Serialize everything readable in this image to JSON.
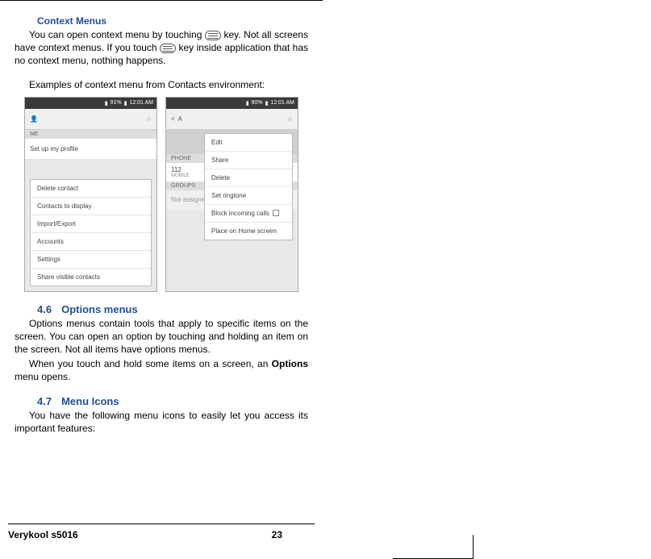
{
  "headings": {
    "context_menus": "Context Menus",
    "options_menus_num": "4.6",
    "options_menus_label": "Options menus",
    "menu_icons_num": "4.7",
    "menu_icons_label": "Menu Icons"
  },
  "paragraphs": {
    "p1_a": "You can open context menu by touching ",
    "p1_b": " key. Not all screens have context menus. If you touch ",
    "p1_c": " key inside application that has no context menu, nothing happens.",
    "examples": "Examples of context menu from Contacts environment:",
    "opt1": "Options menus contain tools that apply to specific items on the screen. You can open an option by touching and holding an item on the screen. Not all items have options menus.",
    "opt2a": "When you touch and hold some items on a screen, an ",
    "opt2b": "Options",
    "opt2c": " menu opens.",
    "icons": "You have the following menu icons to easily let you access its important features:"
  },
  "shot1": {
    "status": "91%",
    "time": "12:01 AM",
    "me": "ME",
    "profile": "Set up my profile",
    "menu": [
      "Delete contact",
      "Contacts to display",
      "Import/Export",
      "Accounts",
      "Settings",
      "Share visible contacts"
    ]
  },
  "shot2": {
    "status": "90%",
    "time": "12:01 AM",
    "back": "A",
    "phone_label": "PHONE",
    "phone_num": "112",
    "mobile": "MOBILE",
    "groups": "GROUPS",
    "not_assigned": "Not assigned",
    "menu": [
      "Edit",
      "Share",
      "Delete",
      "Set ringtone",
      "Block incoming calls",
      "Place on Home screen"
    ]
  },
  "footer": {
    "device": "Verykool s5016",
    "page": "23"
  }
}
